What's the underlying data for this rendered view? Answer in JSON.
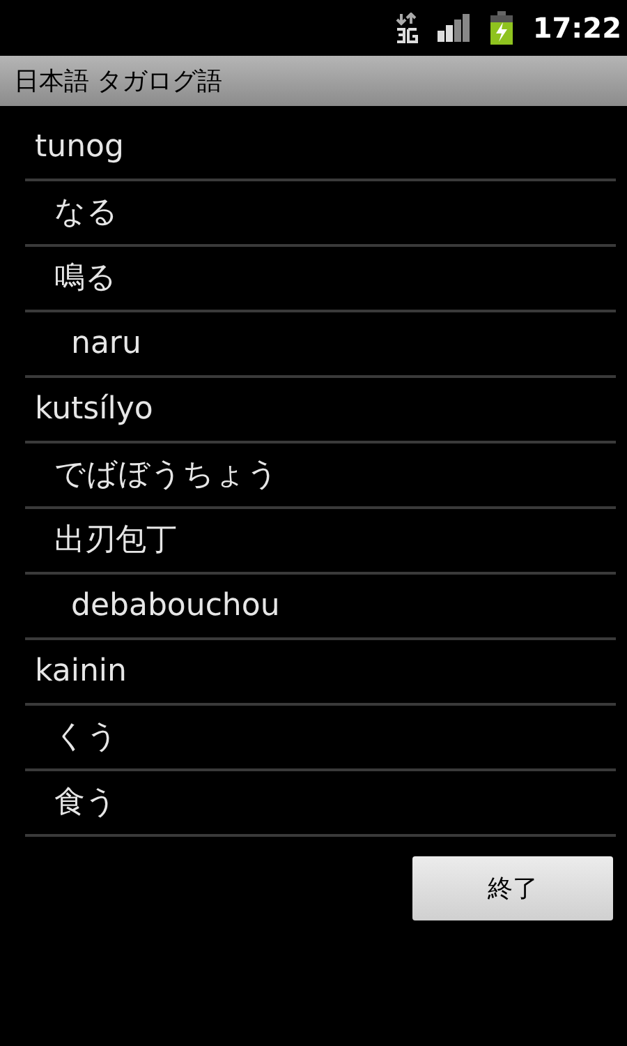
{
  "status_bar": {
    "time": "17:22"
  },
  "window": {
    "title": "日本語 タガログ語"
  },
  "rows": [
    {
      "kind": "word",
      "text": "tunog"
    },
    {
      "kind": "reading",
      "text": "なる"
    },
    {
      "kind": "reading",
      "text": "鳴る"
    },
    {
      "kind": "romaji",
      "text": "naru"
    },
    {
      "kind": "word",
      "text": "kutsílyo"
    },
    {
      "kind": "reading",
      "text": "でばぼうちょう"
    },
    {
      "kind": "reading",
      "text": "出刃包丁"
    },
    {
      "kind": "romaji",
      "text": "debabouchou"
    },
    {
      "kind": "word",
      "text": "kainin"
    },
    {
      "kind": "reading",
      "text": "くう"
    },
    {
      "kind": "reading",
      "text": "食う"
    }
  ],
  "button": {
    "label": "終了"
  }
}
